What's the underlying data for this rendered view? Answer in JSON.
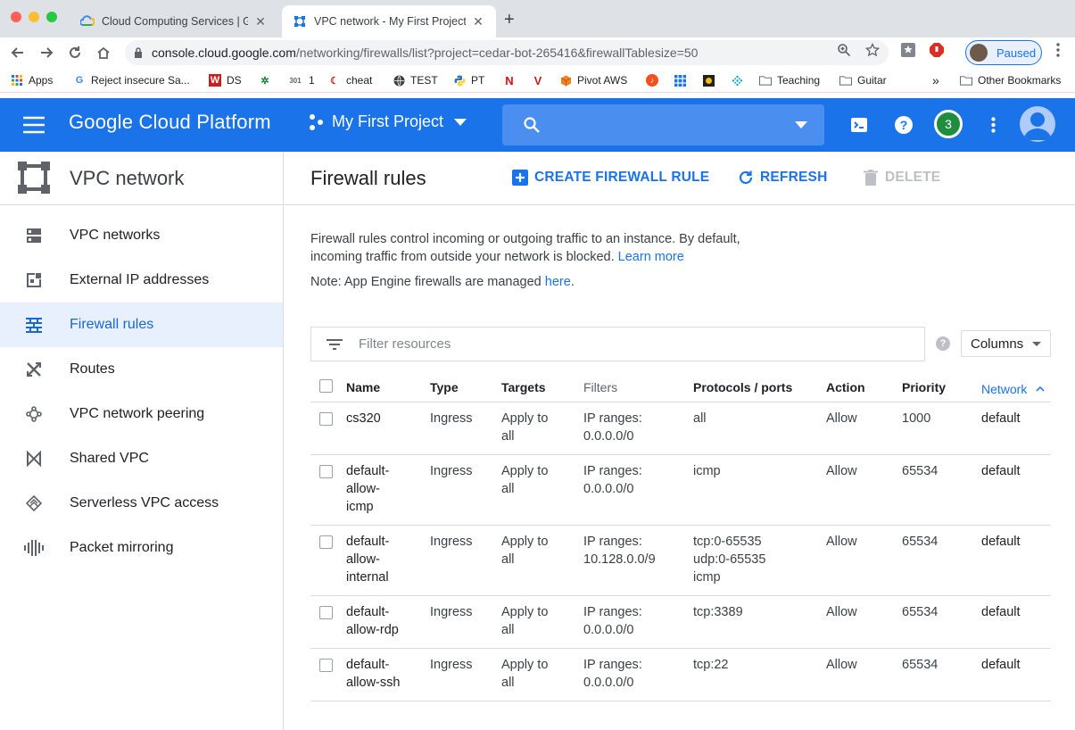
{
  "browser": {
    "tabs": [
      {
        "title": "Cloud Computing Services  |  Go",
        "active": false
      },
      {
        "title": "VPC network - My First Project -",
        "active": true
      }
    ],
    "url_host": "console.cloud.google.com",
    "url_path": "/networking/firewalls/list?project=cedar-bot-265416&firewallTablesize=50",
    "profile_label": "Paused",
    "bookmarks": [
      {
        "label": "Apps",
        "icon": "apps-grid-icon"
      },
      {
        "label": "Reject insecure Sa...",
        "icon": "google-icon"
      },
      {
        "label": "DS",
        "icon": "w-icon"
      },
      {
        "label": "",
        "icon": "leaf-icon"
      },
      {
        "label": "1",
        "icon": "301-icon"
      },
      {
        "label": "cheat",
        "icon": "swirl-icon"
      },
      {
        "label": "TEST",
        "icon": "globe-icon"
      },
      {
        "label": "PT",
        "icon": "python-icon"
      },
      {
        "label": "",
        "icon": "netflix-icon"
      },
      {
        "label": "",
        "icon": "v-icon"
      },
      {
        "label": "Pivot AWS",
        "icon": "cube-icon"
      },
      {
        "label": "",
        "icon": "music-icon"
      },
      {
        "label": "",
        "icon": "grid-icon"
      },
      {
        "label": "",
        "icon": "badge-icon"
      },
      {
        "label": "",
        "icon": "dots-icon"
      },
      {
        "label": "Teaching",
        "icon": "folder-icon"
      },
      {
        "label": "Guitar",
        "icon": "folder-icon"
      }
    ],
    "overflow_label": "»",
    "other_bookmarks": "Other Bookmarks"
  },
  "header": {
    "logo": "Google Cloud Platform",
    "project": "My First Project",
    "notifications": "3",
    "brand_color": "#1a73e8"
  },
  "sidebar": {
    "title": "VPC network",
    "items": [
      {
        "label": "VPC networks",
        "icon": "vpc-networks-icon",
        "active": false
      },
      {
        "label": "External IP addresses",
        "icon": "external-ip-icon",
        "active": false
      },
      {
        "label": "Firewall rules",
        "icon": "firewall-icon",
        "active": true
      },
      {
        "label": "Routes",
        "icon": "routes-icon",
        "active": false
      },
      {
        "label": "VPC network peering",
        "icon": "peering-icon",
        "active": false
      },
      {
        "label": "Shared VPC",
        "icon": "shared-vpc-icon",
        "active": false
      },
      {
        "label": "Serverless VPC access",
        "icon": "serverless-icon",
        "active": false
      },
      {
        "label": "Packet mirroring",
        "icon": "packet-mirroring-icon",
        "active": false
      }
    ]
  },
  "main": {
    "title": "Firewall rules",
    "actions": {
      "create": "CREATE FIREWALL RULE",
      "refresh": "REFRESH",
      "delete": "DELETE"
    },
    "intro_text": "Firewall rules control incoming or outgoing traffic to an instance. By default, incoming traffic from outside your network is blocked.",
    "learn_more": "Learn more",
    "note_prefix": "Note: App Engine firewalls are managed",
    "note_link": "here",
    "note_suffix": ".",
    "filter_placeholder": "Filter resources",
    "columns_label": "Columns",
    "table": {
      "headers": {
        "name": "Name",
        "type": "Type",
        "targets": "Targets",
        "filters": "Filters",
        "protocols": "Protocols / ports",
        "action": "Action",
        "priority": "Priority",
        "network": "Network"
      },
      "rows": [
        {
          "name": [
            "cs320"
          ],
          "type": "Ingress",
          "targets": [
            "Apply to",
            "all"
          ],
          "filters": [
            "IP ranges:",
            "0.0.0.0/0"
          ],
          "protocols": [
            "all"
          ],
          "action": "Allow",
          "priority": "1000",
          "network": "default"
        },
        {
          "name": [
            "default-",
            "allow-",
            "icmp"
          ],
          "type": "Ingress",
          "targets": [
            "Apply to",
            "all"
          ],
          "filters": [
            "IP ranges:",
            "0.0.0.0/0"
          ],
          "protocols": [
            "icmp"
          ],
          "action": "Allow",
          "priority": "65534",
          "network": "default"
        },
        {
          "name": [
            "default-",
            "allow-",
            "internal"
          ],
          "type": "Ingress",
          "targets": [
            "Apply to",
            "all"
          ],
          "filters": [
            "IP ranges:",
            "10.128.0.0/9"
          ],
          "protocols": [
            "tcp:0-65535",
            "udp:0-65535",
            "icmp"
          ],
          "action": "Allow",
          "priority": "65534",
          "network": "default"
        },
        {
          "name": [
            "default-",
            "allow-rdp"
          ],
          "type": "Ingress",
          "targets": [
            "Apply to",
            "all"
          ],
          "filters": [
            "IP ranges:",
            "0.0.0.0/0"
          ],
          "protocols": [
            "tcp:3389"
          ],
          "action": "Allow",
          "priority": "65534",
          "network": "default"
        },
        {
          "name": [
            "default-",
            "allow-ssh"
          ],
          "type": "Ingress",
          "targets": [
            "Apply to",
            "all"
          ],
          "filters": [
            "IP ranges:",
            "0.0.0.0/0"
          ],
          "protocols": [
            "tcp:22"
          ],
          "action": "Allow",
          "priority": "65534",
          "network": "default"
        }
      ]
    }
  }
}
